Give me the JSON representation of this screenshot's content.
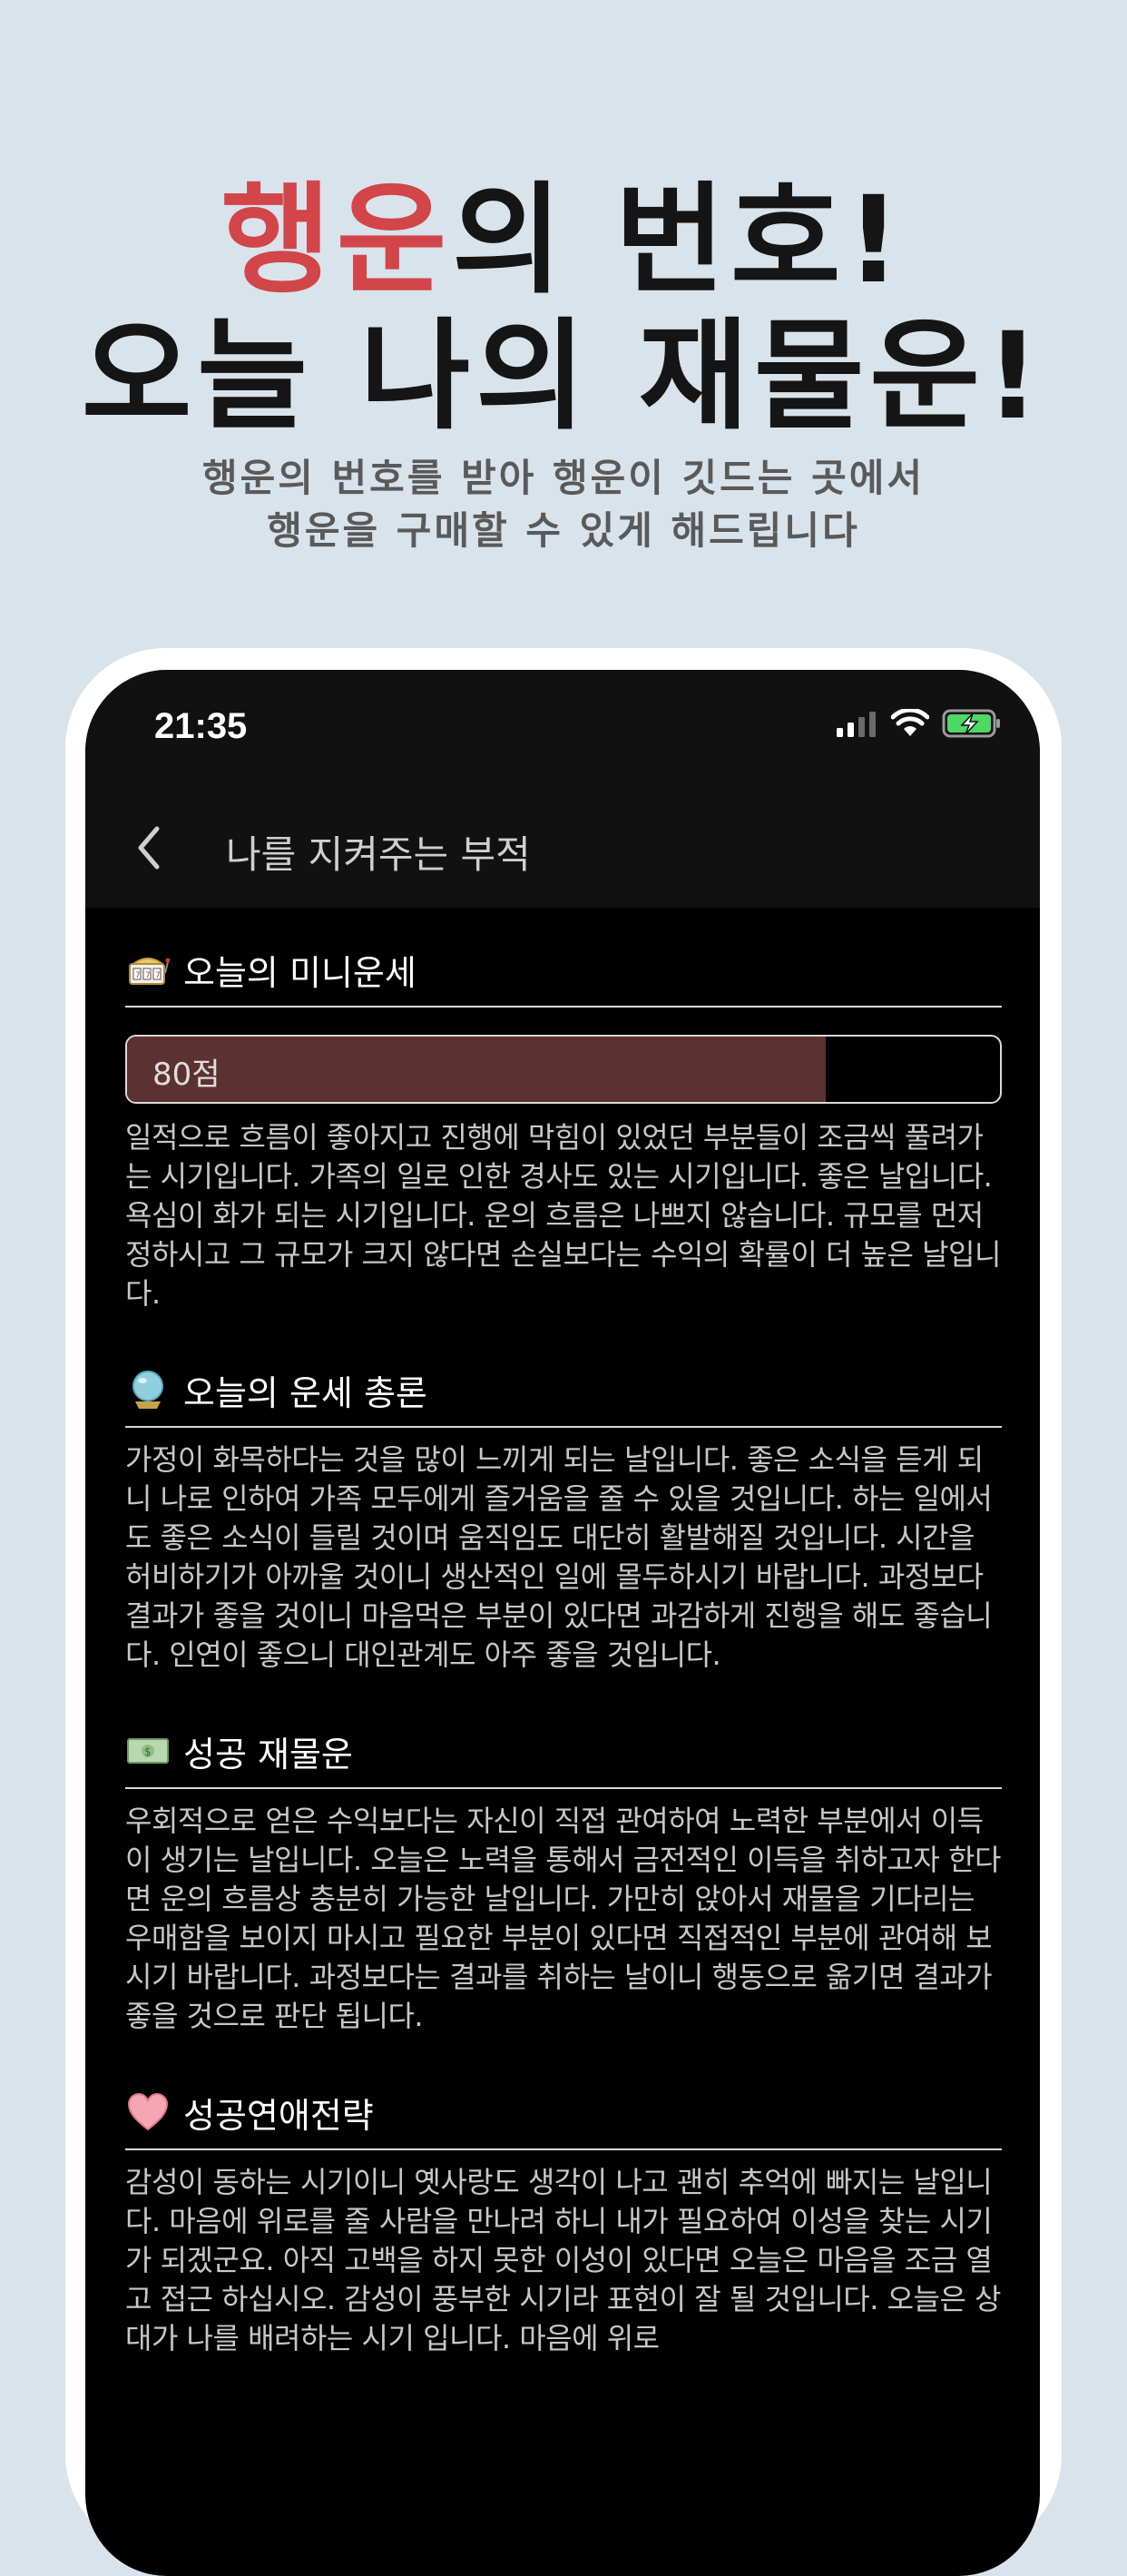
{
  "promo": {
    "headline_accent": "행운",
    "headline_line1_rest": "의 번호!",
    "headline_line2": "오늘 나의 재물운!",
    "subhead_line1": "행운의 번호를 받아 행운이 깃드는 곳에서",
    "subhead_line2": "행운을 구매할 수 있게 해드립니다"
  },
  "status_bar": {
    "time": "21:35",
    "icons": [
      "signal-icon",
      "wifi-icon",
      "battery-charging-icon"
    ]
  },
  "nav": {
    "back_icon": "chevron-left-icon",
    "title": "나를 지켜주는 부적"
  },
  "colors": {
    "accent": "#d24548",
    "background": "#d9e3ec",
    "score_fill": "#5c3131"
  },
  "sections": [
    {
      "icon": "slot-machine-icon",
      "title": "오늘의 미니운세",
      "score_label": "80점",
      "score_value": 80,
      "body": "일적으로 흐름이 좋아지고 진행에 막힘이 있었던 부분들이 조금씩 풀려가는 시기입니다. 가족의 일로 인한 경사도 있는 시기입니다. 좋은 날입니다. 욕심이 화가 되는 시기입니다. 운의 흐름은 나쁘지 않습니다. 규모를 먼저 정하시고 그 규모가 크지 않다면 손실보다는 수익의 확률이 더 높은 날입니다."
    },
    {
      "icon": "crystal-ball-icon",
      "title": "오늘의 운세 총론",
      "body": "가정이 화목하다는 것을 많이 느끼게 되는 날입니다. 좋은 소식을 듣게 되니 나로 인하여 가족 모두에게 즐거움을 줄 수 있을 것입니다. 하는 일에서도 좋은 소식이 들릴 것이며 움직임도 대단히 활발해질 것입니다. 시간을 허비하기가 아까울 것이니 생산적인 일에 몰두하시기 바랍니다. 과정보다 결과가 좋을 것이니 마음먹은 부분이 있다면 과감하게 진행을 해도 좋습니다. 인연이 좋으니 대인관계도 아주 좋을 것입니다."
    },
    {
      "icon": "money-bill-icon",
      "title": "성공 재물운",
      "body": "우회적으로 얻은 수익보다는 자신이 직접 관여하여 노력한 부분에서 이득이 생기는 날입니다. 오늘은 노력을 통해서 금전적인 이득을 취하고자 한다면 운의 흐름상 충분히 가능한 날입니다. 가만히 앉아서 재물을 기다리는 우매함을 보이지 마시고 필요한 부분이 있다면 직접적인 부분에 관여해 보시기 바랍니다. 과정보다는 결과를 취하는 날이니 행동으로 옮기면 결과가 좋을 것으로 판단 됩니다."
    },
    {
      "icon": "heart-icon",
      "title": "성공연애전략",
      "body": "감성이 동하는 시기이니 옛사랑도 생각이 나고 괜히 추억에 빠지는 날입니다. 마음에 위로를 줄 사람을 만나려 하니 내가 필요하여 이성을 찾는 시기가 되겠군요. 아직 고백을 하지 못한 이성이 있다면 오늘은 마음을 조금 열고 접근 하십시오. 감성이 풍부한 시기라 표현이 잘 될 것입니다. 오늘은 상대가 나를 배려하는 시기 입니다. 마음에 위로"
    }
  ]
}
